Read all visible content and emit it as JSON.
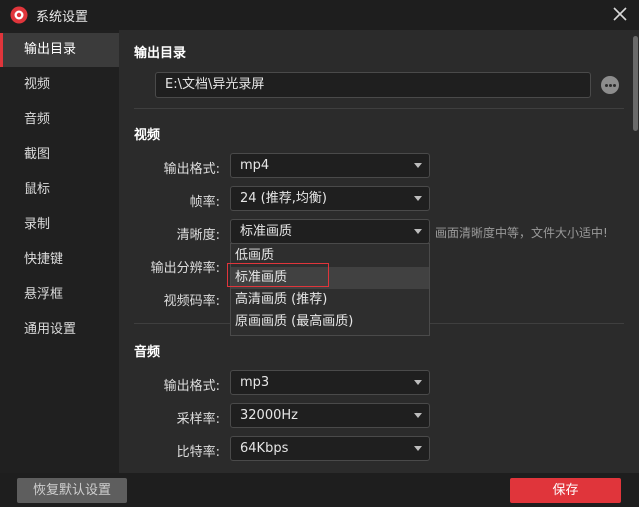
{
  "window": {
    "title": "系统设置",
    "logo_icon": "app-logo-icon",
    "close_icon": "close-icon",
    "accent_color": "#e0353b"
  },
  "sidebar": {
    "items": [
      {
        "label": "输出目录",
        "active": true
      },
      {
        "label": "视频"
      },
      {
        "label": "音频"
      },
      {
        "label": "截图"
      },
      {
        "label": "鼠标"
      },
      {
        "label": "录制"
      },
      {
        "label": "快捷键"
      },
      {
        "label": "悬浮框"
      },
      {
        "label": "通用设置"
      }
    ]
  },
  "output_dir": {
    "section_title": "输出目录",
    "path": "E:\\文档\\异光录屏",
    "more_icon": "more-icon"
  },
  "video": {
    "section_title": "视频",
    "format_label": "输出格式:",
    "format_value": "mp4",
    "fps_label": "帧率:",
    "fps_value": "24 (推荐,均衡)",
    "quality_label": "清晰度:",
    "quality_value": "标准画质",
    "quality_hint": "画面清晰度中等，文件大小适中!",
    "resolution_label": "输出分辨率:",
    "bitrate_label": "视频码率:",
    "quality_options": [
      "低画质",
      "标准画质",
      "高清画质 (推荐)",
      "原画画质 (最高画质)"
    ],
    "quality_highlighted": "标准画质"
  },
  "audio": {
    "section_title": "音频",
    "format_label": "输出格式:",
    "format_value": "mp3",
    "samplerate_label": "采样率:",
    "samplerate_value": "32000Hz",
    "bitrate_label": "比特率:",
    "bitrate_value": "64Kbps"
  },
  "footer": {
    "reset_label": "恢复默认设置",
    "save_label": "保存"
  }
}
